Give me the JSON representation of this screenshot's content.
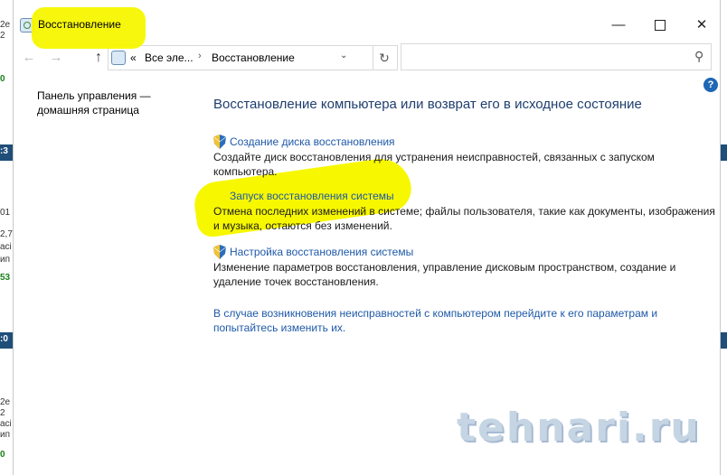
{
  "window": {
    "title": "Восстановление",
    "controls": {
      "minimize": "—",
      "maximize": "",
      "close": "✕"
    }
  },
  "navigation": {
    "back_icon": "arrow-left-icon",
    "forward_icon": "arrow-right-icon",
    "up_icon": "arrow-up-icon",
    "breadcrumb_overflow": "«",
    "breadcrumb": [
      "Все эле...",
      "Восстановление"
    ],
    "address_dropdown": "⌄",
    "refresh": "↻",
    "search_placeholder": "",
    "search_icon": "⚲"
  },
  "sidebar": {
    "home_link": "Панель управления — домашняя страница"
  },
  "help": {
    "label": "?"
  },
  "main": {
    "title": "Восстановление компьютера или возврат его в исходное состояние",
    "tasks": [
      {
        "link": "Создание диска восстановления",
        "description": "Создайте диск восстановления для устранения неисправностей, связанных с запуском компьютера."
      },
      {
        "link": "Запуск восстановления системы",
        "description": "Отмена последних изменений в системе; файлы пользователя, такие как документы, изображения и музыка, остаются без изменений."
      },
      {
        "link": "Настройка восстановления системы",
        "description": "Изменение параметров восстановления, управление дисковым пространством, создание и удаление точек восстановления."
      }
    ],
    "bottom_link": "В случае возникновения неисправностей с компьютером перейдите к его параметрам и попытайтесь изменить их."
  },
  "watermark": "tehnari.ru",
  "background_window": {
    "left_texts": [
      "2e",
      "2",
      "0",
      ":3",
      "01",
      "2,7",
      "асі",
      "ип",
      "53",
      ":0",
      "2e",
      "2",
      "асі",
      "ип",
      "0"
    ]
  },
  "colors": {
    "link": "#1e59a8",
    "title": "#1e3e6e",
    "highlight": "#f7f700",
    "help": "#1e67b6"
  }
}
